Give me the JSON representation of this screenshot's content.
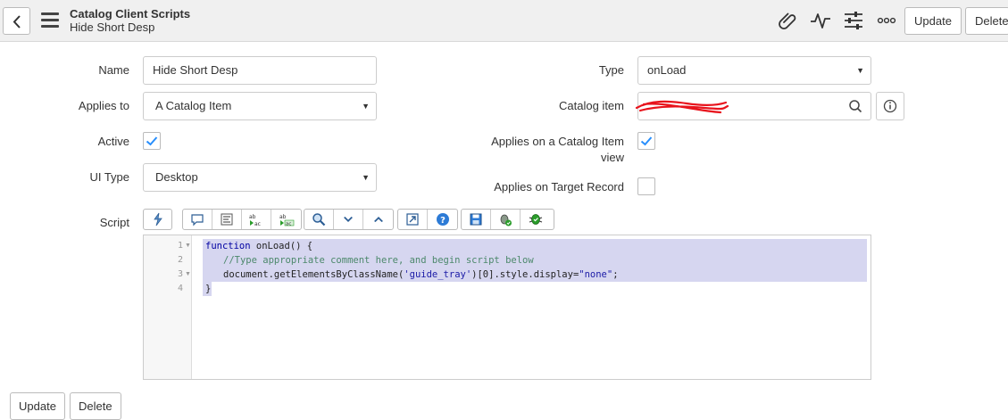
{
  "header": {
    "title": "Catalog Client Scripts",
    "subtitle": "Hide Short Desp",
    "update_label": "Update",
    "delete_label": "Delete",
    "icons": [
      "chevron-left-icon",
      "hamburger-menu-icon",
      "paperclip-icon",
      "activity-icon",
      "sliders-icon",
      "more-icon"
    ]
  },
  "form": {
    "name": {
      "label": "Name",
      "value": "Hide Short Desp"
    },
    "applies_to": {
      "label": "Applies to",
      "value": "A Catalog Item"
    },
    "active": {
      "label": "Active",
      "checked": true
    },
    "ui_type": {
      "label": "UI Type",
      "value": "Desktop"
    },
    "type": {
      "label": "Type",
      "value": "onLoad"
    },
    "catalog_item": {
      "label": "Catalog item"
    },
    "applies_on_view": {
      "label_line1": "Applies on a Catalog Item",
      "label_line2": "view",
      "checked": true
    },
    "applies_on_target": {
      "label": "Applies on Target Record",
      "checked": false
    },
    "script_label": "Script"
  },
  "editor": {
    "line_numbers": [
      "1",
      "2",
      "3",
      "4"
    ],
    "line1": {
      "kw": "function",
      "rest": " onLoad() {"
    },
    "line2": "//Type appropriate comment here, and begin script below",
    "line3": {
      "pre": "document.getElementsByClassName(",
      "str1": "'guide_tray'",
      "mid": ")[0].style.display=",
      "str2": "\"none\"",
      "end": ";"
    },
    "line4": "}"
  },
  "footer": {
    "update_label": "Update",
    "delete_label": "Delete"
  },
  "colors": {
    "accent": "#278efc",
    "selection": "#d6d6f0",
    "redaction": "#e8131c"
  }
}
